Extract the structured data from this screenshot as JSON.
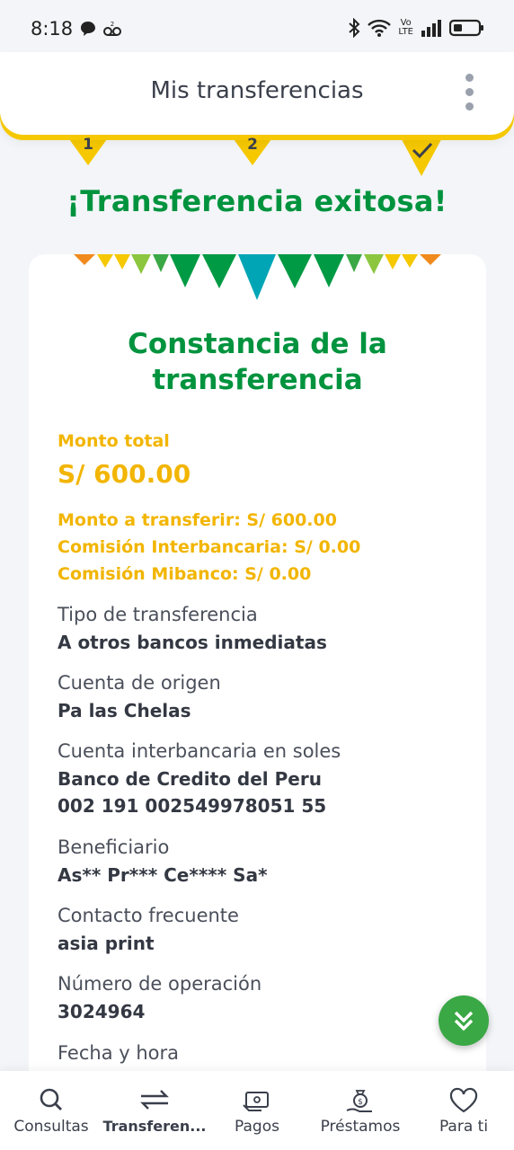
{
  "status_bar": {
    "time": "8:18",
    "network_top": "Vo",
    "network_bottom": "LTE"
  },
  "header": {
    "title": "Mis transferencias"
  },
  "stepper": {
    "steps": [
      "1",
      "2",
      "✓"
    ]
  },
  "success_title": "¡Transferencia exitosa!",
  "card": {
    "title_line1": "Constancia de la",
    "title_line2": "transferencia",
    "monto_total_label": "Monto total",
    "monto_total_value": "S/ 600.00",
    "monto_transferir": "Monto a transferir: S/ 600.00",
    "comision_interbancaria": "Comisión Interbancaria: S/ 0.00",
    "comision_mibanco": "Comisión Mibanco: S/ 0.00",
    "fields": [
      {
        "label": "Tipo de transferencia",
        "value": "A otros bancos inmediatas"
      },
      {
        "label": "Cuenta de origen",
        "value": "Pa las Chelas"
      },
      {
        "label": "Cuenta interbancaria en soles",
        "value": "Banco de Credito del Peru",
        "value2": "002 191 002549978051 55"
      },
      {
        "label": "Beneficiario",
        "value": "As** Pr*** Ce**** Sa*"
      },
      {
        "label": "Contacto frecuente",
        "value": "asia print"
      },
      {
        "label": "Número de operación",
        "value": "3024964"
      },
      {
        "label": "Fecha y hora"
      }
    ]
  },
  "bottom_nav": {
    "items": [
      {
        "label": "Consultas",
        "icon": "search-icon"
      },
      {
        "label": "Transferen...",
        "icon": "transfer-arrows-icon",
        "active": true
      },
      {
        "label": "Pagos",
        "icon": "payment-icon"
      },
      {
        "label": "Préstamos",
        "icon": "loan-icon"
      },
      {
        "label": "Para ti",
        "icon": "heart-icon"
      }
    ]
  },
  "colors": {
    "brand_yellow": "#f5c800",
    "brand_green": "#00933e",
    "amount_yellow": "#f2b500"
  }
}
